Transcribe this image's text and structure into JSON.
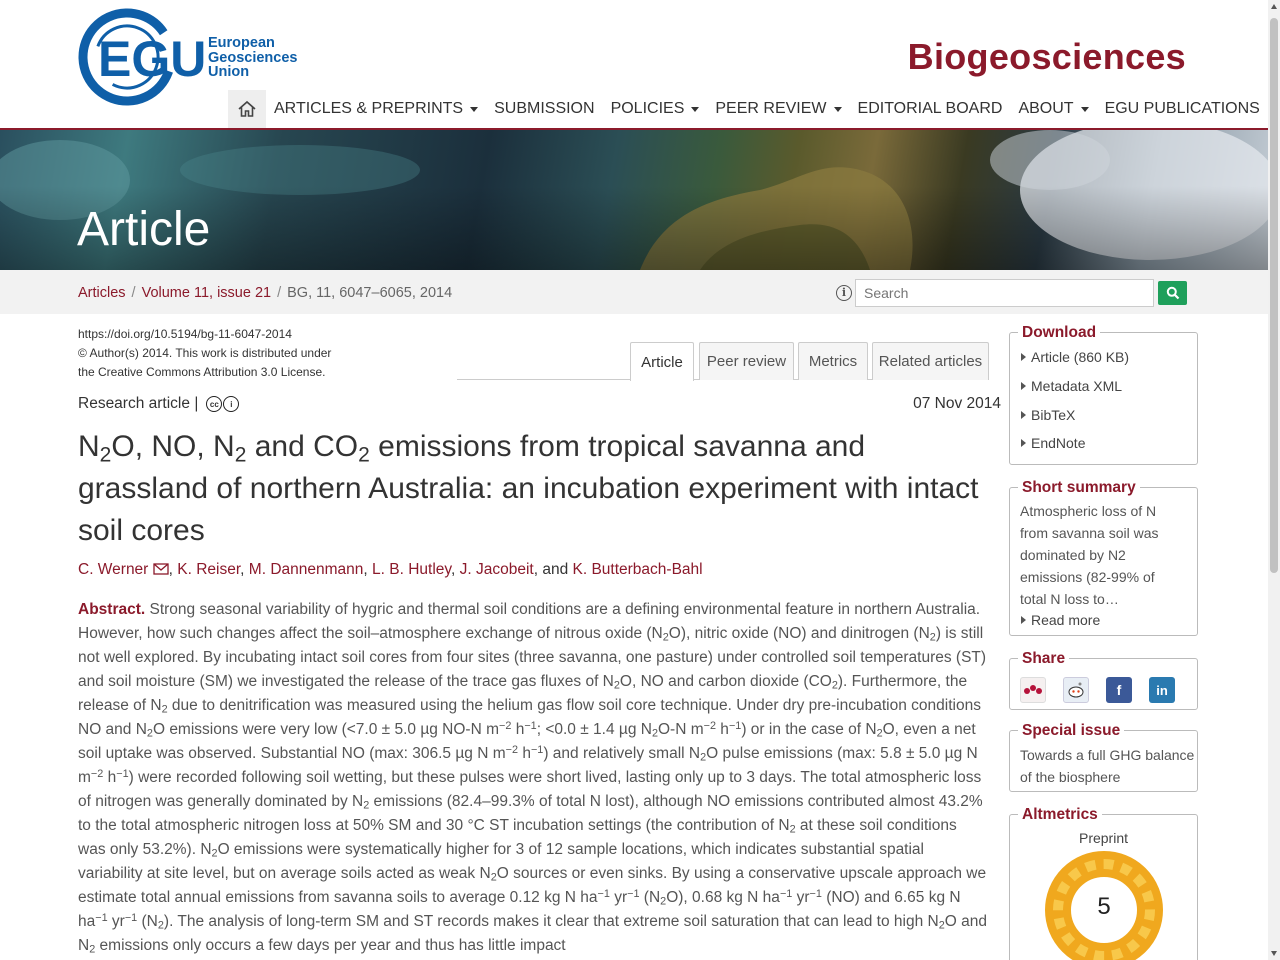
{
  "logo": {
    "line1": "European",
    "line2": "Geosciences",
    "line3": "Union"
  },
  "journal": {
    "title": "Biogeosciences"
  },
  "nav": {
    "items": [
      "ARTICLES & PREPRINTS",
      "SUBMISSION",
      "POLICIES",
      "PEER REVIEW",
      "EDITORIAL BOARD",
      "ABOUT",
      "EGU PUBLICATIONS"
    ]
  },
  "banner": {
    "title": "Article"
  },
  "breadcrumb": {
    "link1": "Articles",
    "link2": "Volume 11, issue 21",
    "current": "BG, 11, 6047–6065, 2014"
  },
  "search": {
    "placeholder": "Search"
  },
  "meta": {
    "doi": "https://doi.org/10.5194/bg-11-6047-2014",
    "copyright": "© Author(s) 2014. This work is distributed under",
    "license": "the Creative Commons Attribution 3.0 License."
  },
  "tabs": [
    "Article",
    "Peer review",
    "Metrics",
    "Related articles"
  ],
  "article": {
    "type": "Research article",
    "type_sep": "|",
    "date": "07 Nov 2014",
    "authors": [
      "C. Werner",
      "K. Reiser",
      "M. Dannenmann",
      "L. B. Hutley",
      "J. Jacobeit",
      "K. Butterbach-Bahl"
    ],
    "abstract_label": "Abstract."
  },
  "sidebar": {
    "download": {
      "title": "Download",
      "items": [
        "Article (860 KB)",
        "Metadata XML",
        "BibTeX",
        "EndNote"
      ]
    },
    "summary": {
      "title": "Short summary",
      "text": "Atmospheric loss of N from savanna soil was dominated by N2 emissions (82-99% of total N loss to…",
      "more": "Read more"
    },
    "share": {
      "title": "Share"
    },
    "special": {
      "title": "Special issue",
      "text": "Towards a full GHG balance of the biosphere"
    },
    "altmetrics": {
      "title": "Altmetrics",
      "label": "Preprint",
      "score": "5"
    }
  },
  "colors": {
    "brand": "#8b1a2b",
    "egu_blue": "#0f5fa8",
    "search_green": "#1fa05b"
  }
}
